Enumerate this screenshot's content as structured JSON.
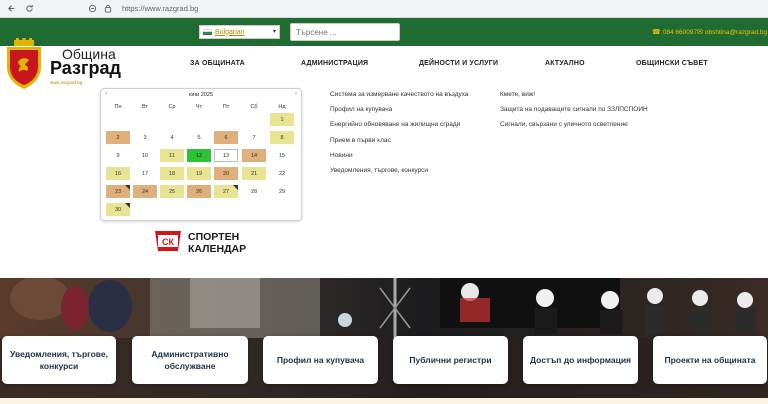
{
  "browser": {
    "url": "https://www.razgrad.bg"
  },
  "topbar": {
    "language": "Bulgarian",
    "search_placeholder": "Търсене ...",
    "phone": "084 660097",
    "email": "obshtina@razgrad.bg"
  },
  "logo": {
    "title1": "Община",
    "title2": "Разград",
    "subtitle": "www.razgrad.bg"
  },
  "nav": {
    "items": [
      {
        "label": "ЗА ОБЩИНАТА"
      },
      {
        "label": "АДМИНИСТРАЦИЯ"
      },
      {
        "label": "ДЕЙНОСТИ И УСЛУГИ"
      },
      {
        "label": "АКТУАЛНО"
      },
      {
        "label": "ОБЩИНСКИ СЪВЕТ"
      }
    ]
  },
  "calendar": {
    "title": "юни 2025",
    "prev": "‹",
    "next": "›",
    "weekdays": [
      "Пн",
      "Вт",
      "Ср",
      "Чт",
      "Пт",
      "Сб",
      "Нд"
    ],
    "days": [
      {
        "n": "",
        "t": ""
      },
      {
        "n": "",
        "t": ""
      },
      {
        "n": "",
        "t": ""
      },
      {
        "n": "",
        "t": ""
      },
      {
        "n": "",
        "t": ""
      },
      {
        "n": "",
        "t": ""
      },
      {
        "n": "1",
        "t": "yellow"
      },
      {
        "n": "2",
        "t": "orange"
      },
      {
        "n": "3",
        "t": ""
      },
      {
        "n": "4",
        "t": ""
      },
      {
        "n": "5",
        "t": ""
      },
      {
        "n": "6",
        "t": "orange"
      },
      {
        "n": "7",
        "t": ""
      },
      {
        "n": "8",
        "t": "yellow"
      },
      {
        "n": "9",
        "t": ""
      },
      {
        "n": "10",
        "t": ""
      },
      {
        "n": "11",
        "t": "yellow"
      },
      {
        "n": "12",
        "t": "green"
      },
      {
        "n": "13",
        "t": "today"
      },
      {
        "n": "14",
        "t": "orange"
      },
      {
        "n": "15",
        "t": ""
      },
      {
        "n": "16",
        "t": "yellow"
      },
      {
        "n": "17",
        "t": ""
      },
      {
        "n": "18",
        "t": "yellow"
      },
      {
        "n": "19",
        "t": "yellow"
      },
      {
        "n": "20",
        "t": "orange"
      },
      {
        "n": "21",
        "t": "yellow"
      },
      {
        "n": "22",
        "t": ""
      },
      {
        "n": "23",
        "t": "orange",
        "m": true
      },
      {
        "n": "24",
        "t": "orange"
      },
      {
        "n": "25",
        "t": "yellow"
      },
      {
        "n": "26",
        "t": "orange"
      },
      {
        "n": "27",
        "t": "yellow",
        "m": true
      },
      {
        "n": "28",
        "t": ""
      },
      {
        "n": "29",
        "t": ""
      },
      {
        "n": "30",
        "t": "yellow",
        "m": true
      }
    ]
  },
  "sport": {
    "badge": "СК",
    "line1": "СПОРТЕН",
    "line2": "КАЛЕНДАР"
  },
  "links": {
    "col1": [
      "Система за измерване качеството на въздуха",
      "Профил на купувача",
      "Енергийно обновяване на жилищни сгради",
      "Прием в първи клас",
      "Новини",
      "Уведомления, търгове, конкурси"
    ],
    "col2": [
      "Кмете, виж!",
      "Защита на подаващите сигнали по ЗЗЛПСПОИН",
      "Сигнали, свързани с уличното осветление"
    ]
  },
  "cards": [
    {
      "label": "Уведомления, търгове, конкурси"
    },
    {
      "label": "Административно обслужване"
    },
    {
      "label": "Профил на купувача"
    },
    {
      "label": "Публични регистри"
    },
    {
      "label": "Достъп до информация"
    },
    {
      "label": "Проекти на общината"
    }
  ],
  "colors": {
    "topbar_green": "#1f6b32",
    "accent_yellow": "#f2c200",
    "event_yellow": "#e8e494",
    "event_orange": "#e0b07c",
    "event_green": "#2ec235",
    "card_text": "#1f3147"
  }
}
